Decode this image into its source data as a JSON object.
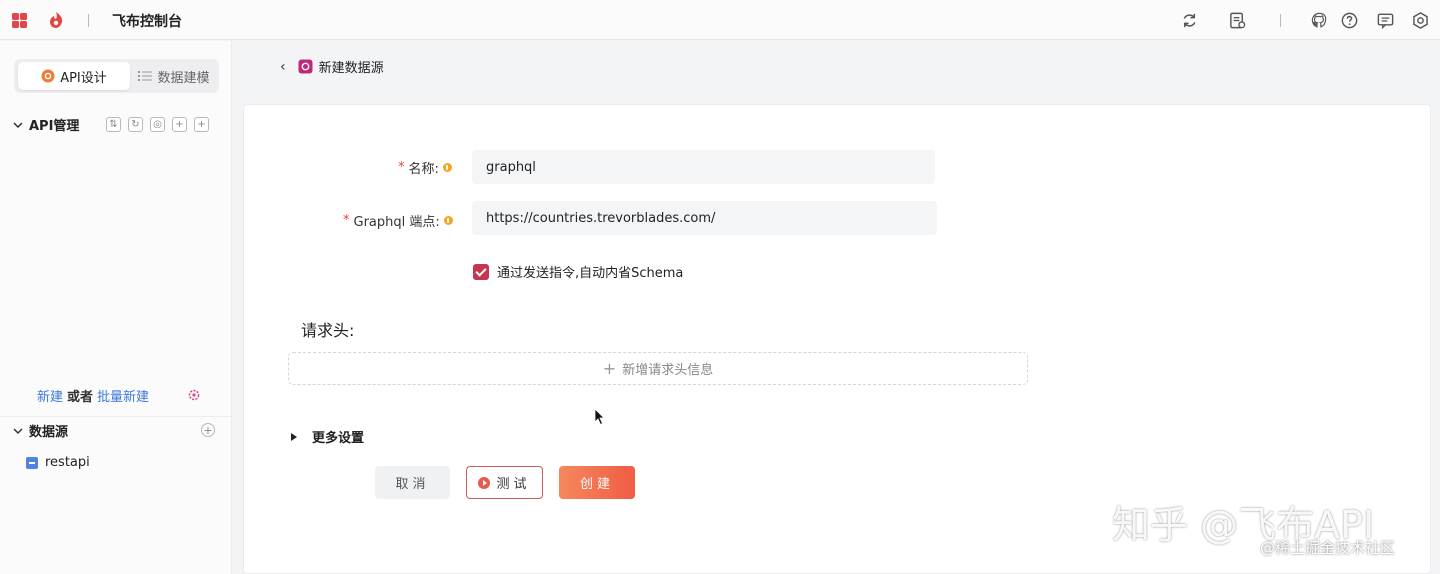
{
  "topbar": {
    "title": "飞布控制台",
    "icons": [
      "grid-icon",
      "logo-icon",
      "refresh-icon",
      "log-icon",
      "github-icon",
      "help-icon",
      "message-icon",
      "settings-icon"
    ]
  },
  "sidebar": {
    "tabs": [
      {
        "label": "API设计",
        "icon": "api-design-icon",
        "active": true
      },
      {
        "label": "数据建模",
        "icon": "list-icon",
        "active": false
      }
    ],
    "api_section": {
      "label": "API管理",
      "actions": [
        "filter-icon",
        "refresh-icon",
        "settings-icon",
        "add-folder-icon",
        "add-icon"
      ]
    },
    "new_row": {
      "new": "新建",
      "or": "或者",
      "batch": "批量新建"
    },
    "datasource_section": {
      "label": "数据源"
    },
    "datasources": [
      {
        "label": "restapi"
      }
    ]
  },
  "header": {
    "back_icon": "chevron-left-icon",
    "title": "新建数据源"
  },
  "form": {
    "name": {
      "label": "名称:",
      "required": "*",
      "value": "graphql"
    },
    "endpoint": {
      "label": "Graphql 端点:",
      "required": "*",
      "value": "https://countries.trevorblades.com/"
    },
    "introspect": {
      "label": "通过发送指令,自动内省Schema",
      "checked": true
    }
  },
  "headers_section": {
    "title": "请求头:",
    "add_label": "新增请求头信息"
  },
  "more_settings": {
    "label": "更多设置"
  },
  "actions": {
    "cancel": "取消",
    "test": "测试",
    "create": "创建"
  },
  "watermark": {
    "main": "知乎 @飞布API",
    "sub": "@稀土掘金技术社区"
  },
  "colors": {
    "accent": "#ef5d45",
    "checkbox": "#c7364f",
    "link": "#3c77d8",
    "required": "#e2483d"
  }
}
